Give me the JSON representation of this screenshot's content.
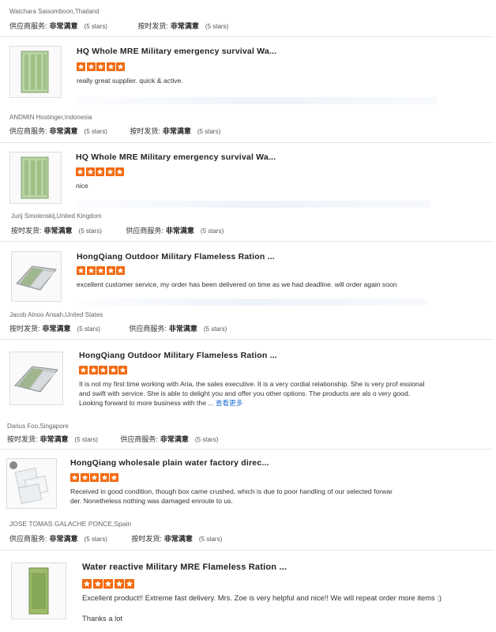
{
  "reviews": [
    {
      "reviewer": "Watchara Saisomboon,Thailand",
      "ratings": [
        {
          "label": "供应商服务:",
          "value": "非常满意",
          "stars": "(5 stars)"
        },
        {
          "label": "按时发货:",
          "value": "非常满意",
          "stars": "(5 stars)"
        }
      ],
      "product": "HQ Whole MRE Military emergency survival Wa...",
      "comment": "really great supplier. quick & active."
    },
    {
      "reviewer": "ANDMIN Hostinger,Indonesia",
      "ratings": [
        {
          "label": "供应商服务:",
          "value": "非常满意",
          "stars": "(5 stars)"
        },
        {
          "label": "按时发货:",
          "value": "非常满意",
          "stars": "(5 stars)"
        }
      ],
      "product": "HQ Whole MRE Military emergency survival Wa...",
      "comment": "nice"
    },
    {
      "reviewer": "Jurij Smolenskij,United Kingdom",
      "ratings": [
        {
          "label": "按时发货:",
          "value": "非常满意",
          "stars": "(5 stars)"
        },
        {
          "label": "供应商服务:",
          "value": "非常满意",
          "stars": "(5 stars)"
        }
      ],
      "product": "HongQiang Outdoor Military Flameless Ration ...",
      "comment": "excellent customer service, my order has been delivered on time as we had deadline. will order again soon"
    },
    {
      "reviewer": "Jacob Ainoo Ansah,United States",
      "ratings": [
        {
          "label": "按时发货:",
          "value": "非常满意",
          "stars": "(5 stars)"
        },
        {
          "label": "供应商服务:",
          "value": "非常满意",
          "stars": "(5 stars)"
        }
      ],
      "product": "HongQiang Outdoor Military Flameless Ration ...",
      "comment": "It is not my first time working with Aria, the sales executive. It is a very cordial relationship. She is very prof essional and swift with service. She is able to delight you and offer you other options.  The products are als o very good. Looking forward to more business with the ...",
      "more": "查看更多"
    },
    {
      "reviewer": "Darius Foo,Singapore",
      "ratings": [
        {
          "label": "按时发货:",
          "value": "非常满意",
          "stars": "(5 stars)"
        },
        {
          "label": "供应商服务:",
          "value": "非常满意",
          "stars": "(5 stars)"
        }
      ],
      "product": "HongQiang wholesale plain water factory direc...",
      "comment": "Received in good condition, though box came crushed, which is due to poor handling of our selected forwar der. Nonetheless nothing was damaged enroute to us."
    },
    {
      "reviewer": "JOSE TOMAS GALACHE PONCE,Spain",
      "ratings": [
        {
          "label": "供应商服务:",
          "value": "非常满意",
          "stars": "(5 stars)"
        },
        {
          "label": "按时发货:",
          "value": "非常满意",
          "stars": "(5 stars)"
        }
      ],
      "product": "Water reactive Military MRE Flameless Ration ...",
      "comment": "Excellent product!! Extreme fast delivery. Mrs. Zoe is very helpful and nice!! We will repeat order more items :)",
      "comment2": "Thanks a lot"
    }
  ],
  "rating_stars": 5,
  "colors": {
    "star": "#f26a10",
    "link": "#1f6fd1"
  },
  "icons": {
    "star": "star-icon",
    "thumb": "product-thumbnail"
  }
}
